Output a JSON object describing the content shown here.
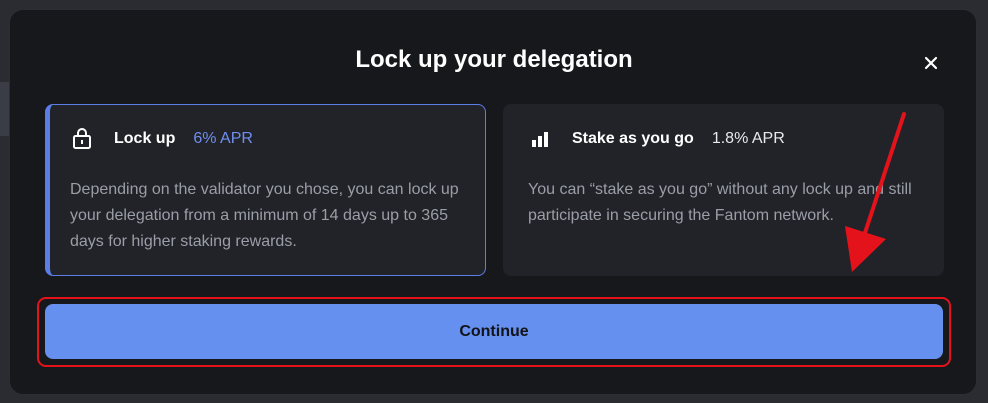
{
  "modal": {
    "title": "Lock up your delegation",
    "close_icon": "close-icon"
  },
  "options": [
    {
      "name": "Lock up",
      "apr": "6% APR",
      "icon": "lock-icon",
      "selected": true,
      "description": "Depending on the validator you chose, you can lock up your delegation from a minimum of 14 days up to 365 days for higher staking rewards."
    },
    {
      "name": "Stake as you go",
      "apr": "1.8% APR",
      "icon": "bar-chart-icon",
      "selected": false,
      "description": "You can “stake as you go” without any lock up and still participate in securing the Fantom network."
    }
  ],
  "actions": {
    "continue_label": "Continue"
  },
  "colors": {
    "accent": "#6590f0",
    "highlight_annotation": "#e4121a"
  }
}
